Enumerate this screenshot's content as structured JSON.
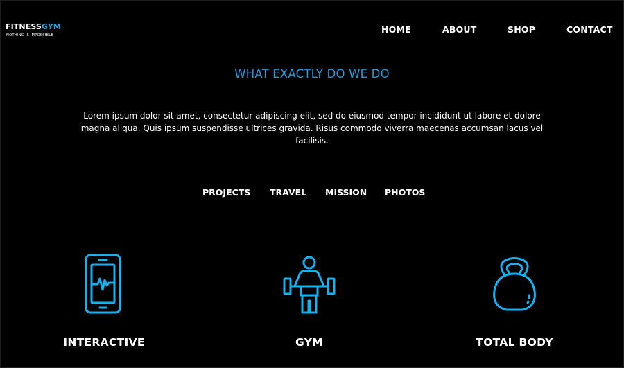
{
  "brand": {
    "name_part1": "FITNESS",
    "name_part2": "GYM",
    "tagline": "NOTHING IS IMPOSSIBLE",
    "accent_color": "#1ea7e1"
  },
  "nav": {
    "items": [
      {
        "label": "HOME"
      },
      {
        "label": "ABOUT"
      },
      {
        "label": "SHOP"
      },
      {
        "label": "CONTACT"
      }
    ]
  },
  "intro": {
    "title": "WHAT EXACTLY DO WE DO",
    "description": "Lorem ipsum dolor sit amet, consectetur adipiscing elit, sed do eiusmod tempor incididunt ut labore et dolore magna aliqua. Quis ipsum suspendisse ultrices gravida. Risus commodo viverra maecenas accumsan lacus vel facilisis."
  },
  "tabs": {
    "items": [
      {
        "label": "PROJECTS"
      },
      {
        "label": "TRAVEL"
      },
      {
        "label": "MISSION"
      },
      {
        "label": "PHOTOS"
      }
    ]
  },
  "features": [
    {
      "label": "INTERACTIVE",
      "icon": "smartphone-heartbeat-icon"
    },
    {
      "label": "GYM",
      "icon": "weightlifter-icon"
    },
    {
      "label": "TOTAL BODY",
      "icon": "kettlebell-icon"
    }
  ],
  "colors": {
    "background": "#000000",
    "icon_stroke": "#14b2f0",
    "title": "#1e9be0",
    "text": "#ffffff"
  }
}
